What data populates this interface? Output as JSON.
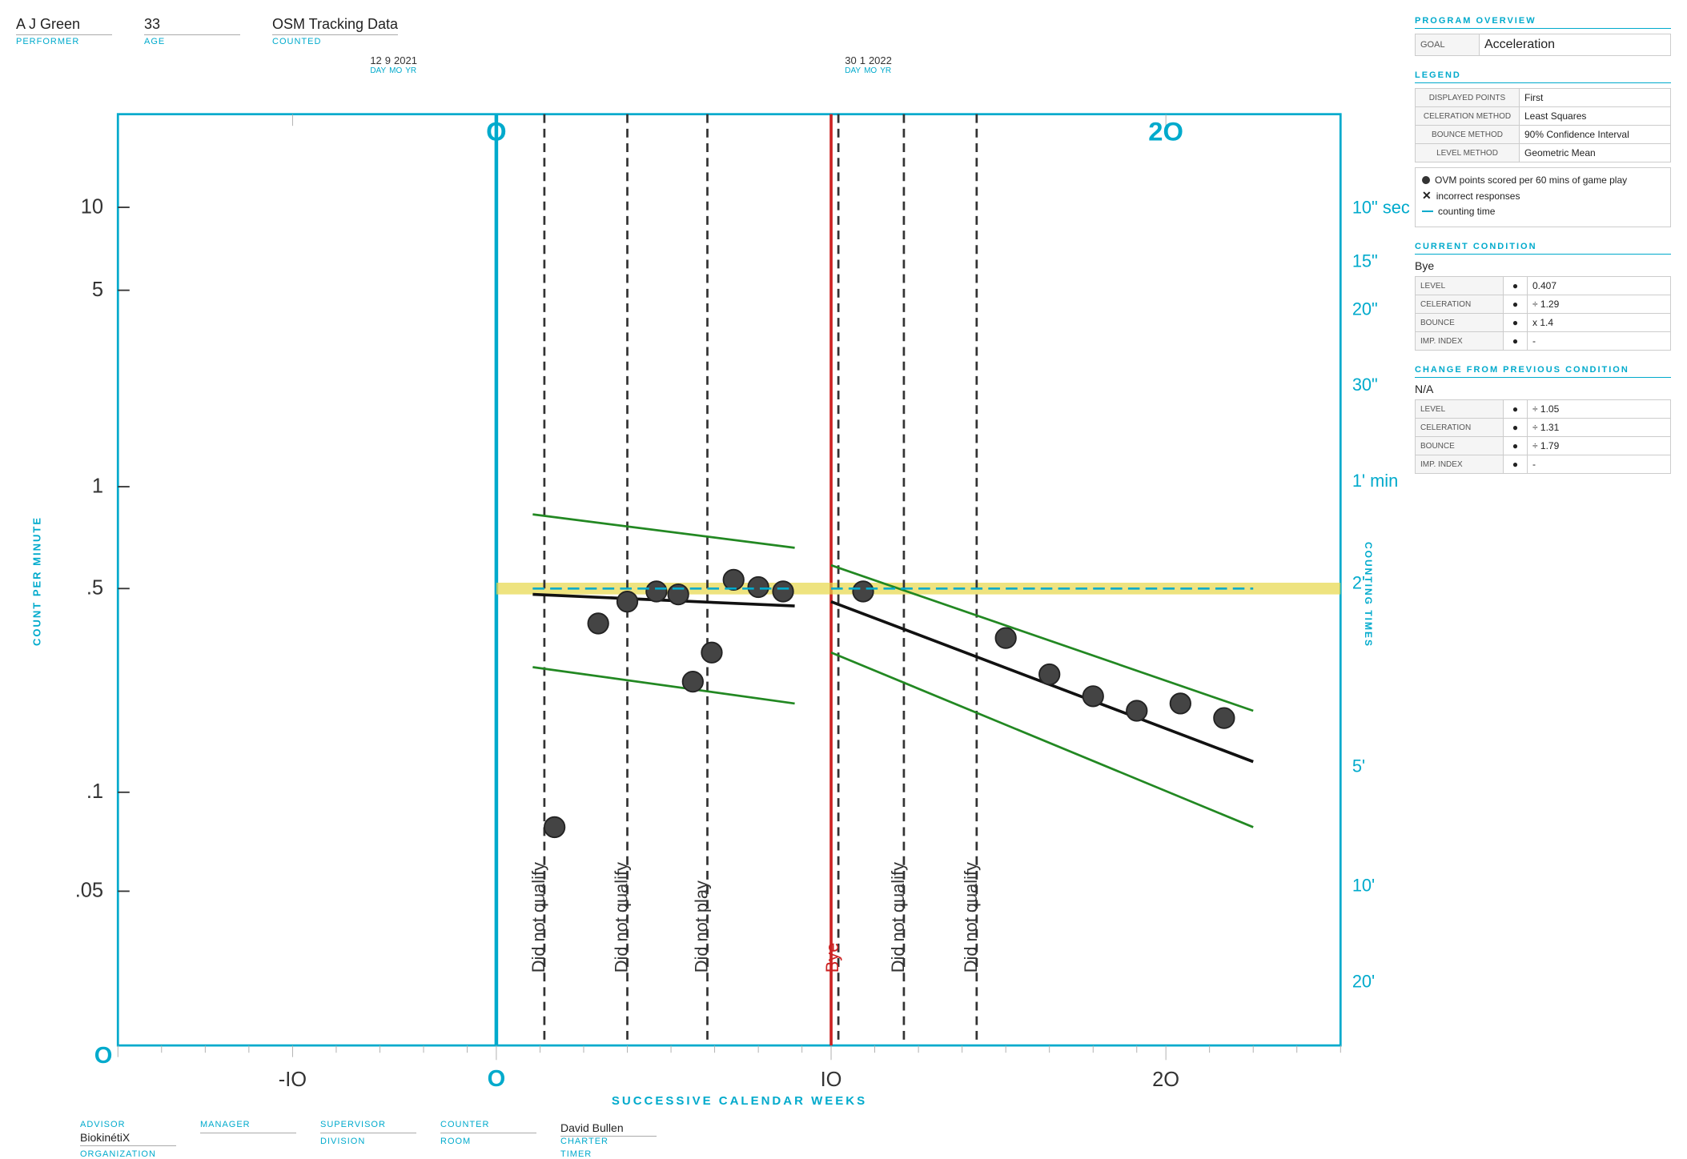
{
  "header": {
    "performer_value": "A J Green",
    "performer_label": "PERFORMER",
    "age_value": "33",
    "age_label": "AGE",
    "counted_source": "OSM Tracking Data",
    "counted_label": "COUNTED"
  },
  "dates": {
    "date1": {
      "day": "12",
      "mo": "9",
      "yr": "2021",
      "day_label": "DAY",
      "mo_label": "MO",
      "yr_label": "YR"
    },
    "date2": {
      "day": "30",
      "mo": "1",
      "yr": "2022",
      "day_label": "DAY",
      "mo_label": "MO",
      "yr_label": "YR"
    }
  },
  "chart": {
    "y_label": "COUNT PER MINUTE",
    "x_label": "SUCCESSIVE CALENDAR WEEKS",
    "y_values": [
      "10",
      "5",
      "1",
      ".5",
      ".1",
      ".05"
    ],
    "x_values": [
      "-10",
      "0",
      "10",
      "20"
    ],
    "phase1_label": "0",
    "phase2_label": "20",
    "counting_times_label": "COUNTING TIMES",
    "right_axis_labels": [
      "10\" sec",
      "15\"",
      "20\"",
      "30\"",
      "1' min",
      "2'",
      "5'",
      "10'",
      "20'"
    ],
    "annotations": [
      "Did not qualify",
      "Did not qualify",
      "Did not play",
      "Bye",
      "Did not qualify",
      "Did not qualify"
    ]
  },
  "program_overview": {
    "title": "PROGRAM OVERVIEW",
    "goal_label": "GOAL",
    "goal_value": "Acceleration"
  },
  "legend": {
    "title": "LEGEND",
    "rows": [
      {
        "key": "DISPLAYED POINTS",
        "value": "First"
      },
      {
        "key": "CELERATION METHOD",
        "value": "Least Squares"
      },
      {
        "key": "BOUNCE METHOD",
        "value": "90% Confidence Interval"
      },
      {
        "key": "LEVEL METHOD",
        "value": "Geometric Mean"
      }
    ],
    "items": [
      {
        "symbol": "dot",
        "text": "OVM points scored per 60 mins of game play"
      },
      {
        "symbol": "cross",
        "text": "incorrect responses"
      },
      {
        "symbol": "dash",
        "text": "counting time"
      }
    ]
  },
  "current_condition": {
    "title": "CURRENT CONDITION",
    "name": "Bye",
    "rows": [
      {
        "key": "LEVEL",
        "value": "0.407"
      },
      {
        "key": "CELERATION",
        "value": "÷ 1.29"
      },
      {
        "key": "BOUNCE",
        "value": "x 1.4"
      },
      {
        "key": "IMP. INDEX",
        "value": "-"
      }
    ]
  },
  "change_from_previous": {
    "title": "CHANGE FROM PREVIOUS CONDITION",
    "name": "N/A",
    "rows": [
      {
        "key": "LEVEL",
        "value": "÷ 1.05"
      },
      {
        "key": "CELERATION",
        "value": "÷ 1.31"
      },
      {
        "key": "BOUNCE",
        "value": "÷ 1.79"
      },
      {
        "key": "IMP. INDEX",
        "value": "-"
      }
    ]
  },
  "footer": {
    "advisor_label": "ADVISOR",
    "advisor_value": "BiokinétiX",
    "manager_label": "MANAGER",
    "manager_value": "",
    "supervisor_label": "SUPERVISOR",
    "supervisor_value": "",
    "counter_label": "COUNTER",
    "counter_value": "",
    "charter_label": "CHARTER",
    "charter_value": "David Bullen",
    "organization_label": "ORGANIZATION",
    "organization_value": "",
    "division_label": "DIVISION",
    "division_value": "",
    "room_label": "ROOM",
    "room_value": "",
    "timer_label": "TIMER",
    "timer_value": ""
  }
}
